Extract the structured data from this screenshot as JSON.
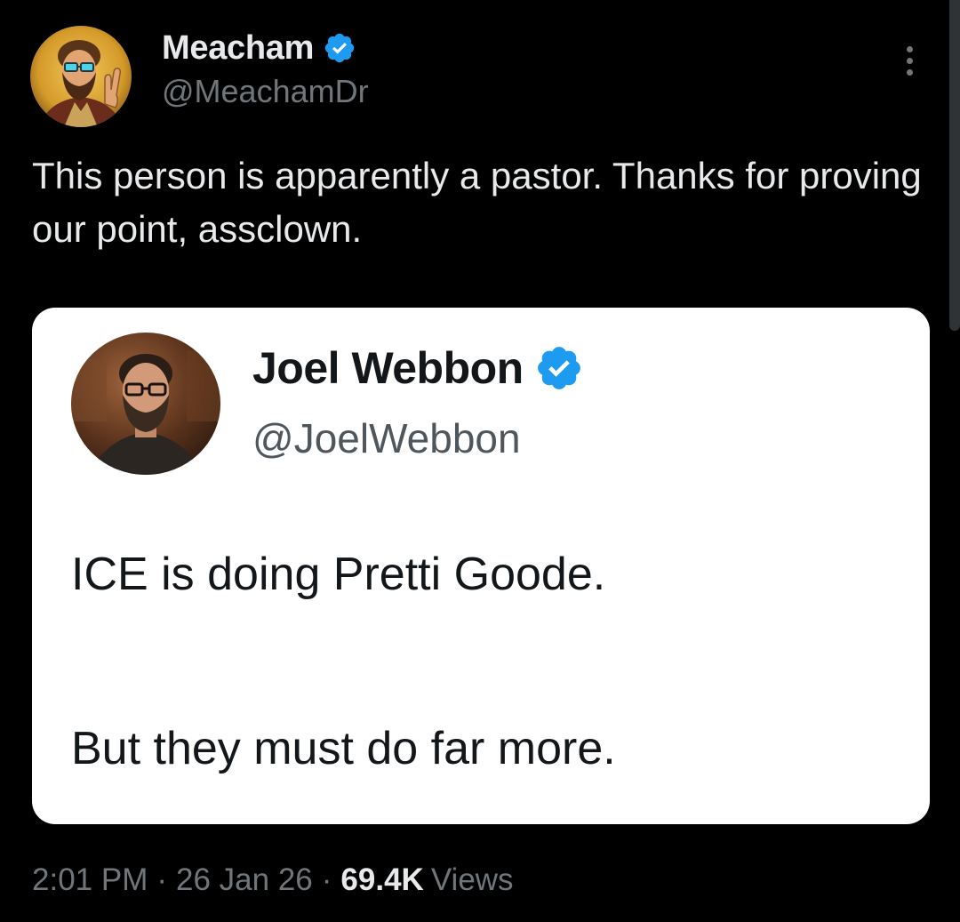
{
  "author": {
    "name": "Meacham",
    "handle": "@MeachamDr",
    "verified": true,
    "avatar": "bearded-man-peace-sign-illustration"
  },
  "tweet": {
    "text": "This person is apparently a pastor. Thanks for proving our point, assclown."
  },
  "quoted_tweet": {
    "author_name": "Joel Webbon",
    "author_handle": "@JoelWebbon",
    "verified": true,
    "avatar": "bearded-man-with-glasses-photo",
    "line1": "ICE is doing Pretti Goode.",
    "line2": "But they must do far more."
  },
  "meta": {
    "time": "2:01 PM",
    "separator": "·",
    "date": "26 Jan 26",
    "views_count": "69.4K",
    "views_label": "Views"
  },
  "icons": {
    "verified_badge": "verified-badge-icon",
    "more": "more-options-icon"
  },
  "colors": {
    "background": "#000000",
    "primary_text": "#e7e9ea",
    "secondary_text": "#71767b",
    "verified_blue": "#1d9bf0",
    "card_background": "#ffffff"
  }
}
